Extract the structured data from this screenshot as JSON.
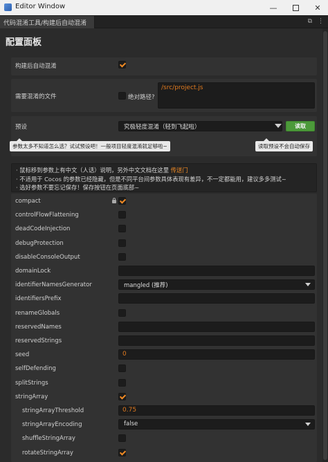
{
  "window": {
    "title": "Editor Window"
  },
  "tab": {
    "label": "代码混淆工具/构建后自动混淆"
  },
  "panel": {
    "title": "配置面板"
  },
  "build": {
    "label": "构建后自动混淆",
    "checked": true
  },
  "files": {
    "label": "需要混淆的文件",
    "absolute_label": "绝对路径?",
    "value": "/src/project.js"
  },
  "preset": {
    "label": "预设",
    "selected": "究极轻度混淆（轻到飞起啦）",
    "read_button": "读取",
    "tooltip_left": "参数太多不知道怎么选？试试预设吧！一般项目轻度混淆就足够啦~",
    "tooltip_right": "读取预设不会自动保存"
  },
  "info": {
    "line1_text": "· 鼠标移到参数上有中文（人话）说明，另外中文文档在这里",
    "line1_link": "传送门",
    "line2": "· 不适用于 Cocos 的参数已经隐藏，但是不同平台间参数具体表现有差异，不一定都能用，建议多多测试~",
    "line3": "· 选好参数不要忘记保存！保存按钮在页面底部~"
  },
  "options": [
    {
      "name": "compact",
      "type": "checkbox",
      "checked": true,
      "locked": true
    },
    {
      "name": "controlFlowFlattening",
      "type": "checkbox",
      "checked": false
    },
    {
      "name": "deadCodeInjection",
      "type": "checkbox",
      "checked": false
    },
    {
      "name": "debugProtection",
      "type": "checkbox",
      "checked": false
    },
    {
      "name": "disableConsoleOutput",
      "type": "checkbox",
      "checked": false
    },
    {
      "name": "domainLock",
      "type": "text",
      "value": ""
    },
    {
      "name": "identifierNamesGenerator",
      "type": "select",
      "value": "mangled (推荐)"
    },
    {
      "name": "identifiersPrefix",
      "type": "text",
      "value": ""
    },
    {
      "name": "renameGlobals",
      "type": "checkbox",
      "checked": false
    },
    {
      "name": "reservedNames",
      "type": "text",
      "value": ""
    },
    {
      "name": "reservedStrings",
      "type": "text",
      "value": ""
    },
    {
      "name": "seed",
      "type": "text",
      "value": "0"
    },
    {
      "name": "selfDefending",
      "type": "checkbox",
      "checked": false
    },
    {
      "name": "splitStrings",
      "type": "checkbox",
      "checked": false
    },
    {
      "name": "stringArray",
      "type": "checkbox",
      "checked": true
    },
    {
      "name": "stringArrayThreshold",
      "type": "text",
      "value": "0.75",
      "sub": true
    },
    {
      "name": "stringArrayEncoding",
      "type": "select",
      "value": "false",
      "sub": true
    },
    {
      "name": "shuffleStringArray",
      "type": "checkbox",
      "checked": false,
      "sub": true
    },
    {
      "name": "rotateStringArray",
      "type": "checkbox",
      "checked": true,
      "sub": true
    }
  ],
  "colors": {
    "accent": "#f08a24",
    "button_green": "#4c9a3a",
    "background": "#2b2b2b"
  }
}
